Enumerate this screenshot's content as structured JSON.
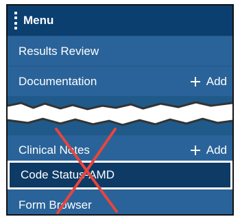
{
  "menu": {
    "title": "Menu",
    "items": [
      {
        "label": "Results Review"
      },
      {
        "label": "Documentation",
        "add_label": "Add"
      },
      {
        "label": "Clinical Notes",
        "add_label": "Add"
      },
      {
        "label": "Code Status-AMD"
      },
      {
        "label": "Form Browser"
      }
    ]
  },
  "colors": {
    "header_bg": "#0b3f70",
    "row_bg": "#2a6399",
    "selected_bg": "#0e3a66",
    "strike_red": "#e8453c"
  },
  "icons": {
    "menu": "vertical-dots-icon",
    "add": "plus-icon",
    "strike": "red-x-icon"
  }
}
